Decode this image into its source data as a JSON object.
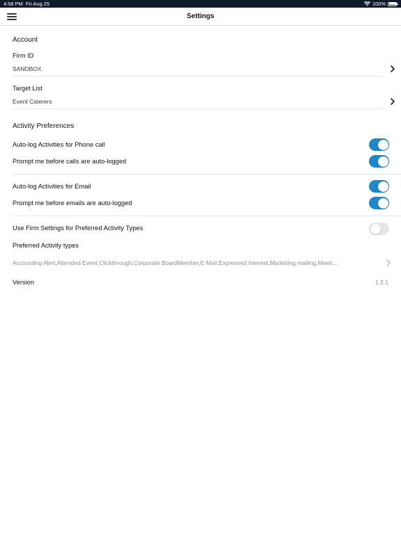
{
  "status_bar": {
    "time": "4:58 PM",
    "date": "Fri Aug 25",
    "battery": "100%"
  },
  "nav": {
    "title": "Settings",
    "menu_icon": "hamburger-menu-icon"
  },
  "account": {
    "header": "Account",
    "firm_id": {
      "label": "Firm ID",
      "value": "SANDBOX"
    },
    "target_list": {
      "label": "Target List",
      "value": "Event Caterers"
    }
  },
  "activity": {
    "header": "Activity Preferences",
    "phone_autolog": {
      "label": "Auto-log Activities for Phone call",
      "on": true
    },
    "phone_prompt": {
      "label": "Prompt me before calls are auto-logged",
      "on": true
    },
    "email_autolog": {
      "label": "Auto-log Activities for Email",
      "on": true
    },
    "email_prompt": {
      "label": "Prompt me before emails are auto-logged",
      "on": true
    },
    "firm_settings": {
      "label": "Use Firm Settings for Preferred Activity Types",
      "on": false
    },
    "preferred_label": "Preferred Activity types",
    "preferred_value": "Accounting Alert,Attended Event,Clickthrough,Corporate BoardMember,E-Mail,Expressed Interest,Marketing mailing,Meeti..."
  },
  "version": {
    "label": "Version",
    "value": "1.2.1"
  },
  "colors": {
    "accent": "#1e88c8",
    "status_bar_bg": "#0e1b2a",
    "toggle_off": "#e6e6e9"
  }
}
